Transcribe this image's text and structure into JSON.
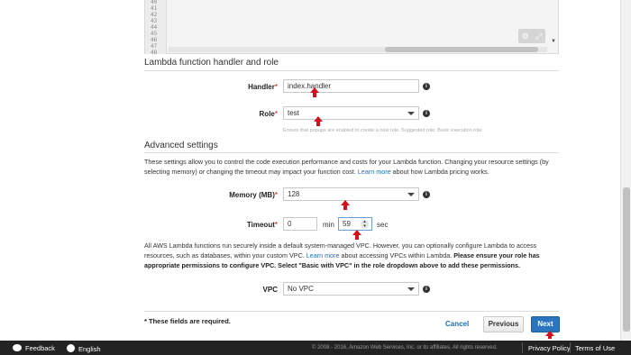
{
  "editor": {
    "line_numbers": [
      "40",
      "41",
      "42",
      "43",
      "44",
      "45",
      "46",
      "47",
      "48"
    ],
    "tools": {
      "settings_icon": "gear-icon",
      "expand_icon": "expand-icon"
    }
  },
  "handler_section": {
    "title": "Lambda function handler and role",
    "handler_label": "Handler",
    "handler_value": "index.handler",
    "role_label": "Role",
    "role_value": "test",
    "role_hint": "Ensure that popups are enabled to create a new role. Suggested role: Basic execution role",
    "required_mark": "*"
  },
  "advanced": {
    "title": "Advanced settings",
    "description_prefix": "These settings allow you to control the code execution performance and costs for your Lambda function. Changing your resource settings (by selecting memory) or changing the timeout may impact your function cost.",
    "description_link": "Learn more",
    "description_suffix": "about how Lambda pricing works.",
    "memory_label": "Memory (MB)",
    "memory_value": "128",
    "timeout_label": "Timeout",
    "timeout_min_value": "0",
    "timeout_min_unit": "min",
    "timeout_sec_value": "59",
    "timeout_sec_unit": "sec",
    "vpc_text_1": "All AWS Lambda functions run securely inside a default system-managed VPC. However, you can optionally configure Lambda to access resources, such as databases, within your custom VPC.",
    "vpc_link": "Learn more",
    "vpc_text_2": "about accessing VPCs within Lambda.",
    "vpc_bold": "Please ensure your role has appropriate permissions to configure VPC. Select \"Basic with VPC\" in the role dropdown above to add these permissions.",
    "vpc_label": "VPC",
    "vpc_value": "No VPC"
  },
  "actions": {
    "required_note": "* These fields are required.",
    "cancel": "Cancel",
    "previous": "Previous",
    "next": "Next"
  },
  "footer": {
    "feedback": "Feedback",
    "language": "English",
    "copyright": "© 2008 - 2016, Amazon Web Services, Inc. or its affiliates. All rights reserved.",
    "privacy": "Privacy Policy",
    "terms": "Terms of Use"
  },
  "colors": {
    "accent_blue": "#2a74c0",
    "annotation_red": "#d4111b",
    "footer_bg": "#232323"
  }
}
